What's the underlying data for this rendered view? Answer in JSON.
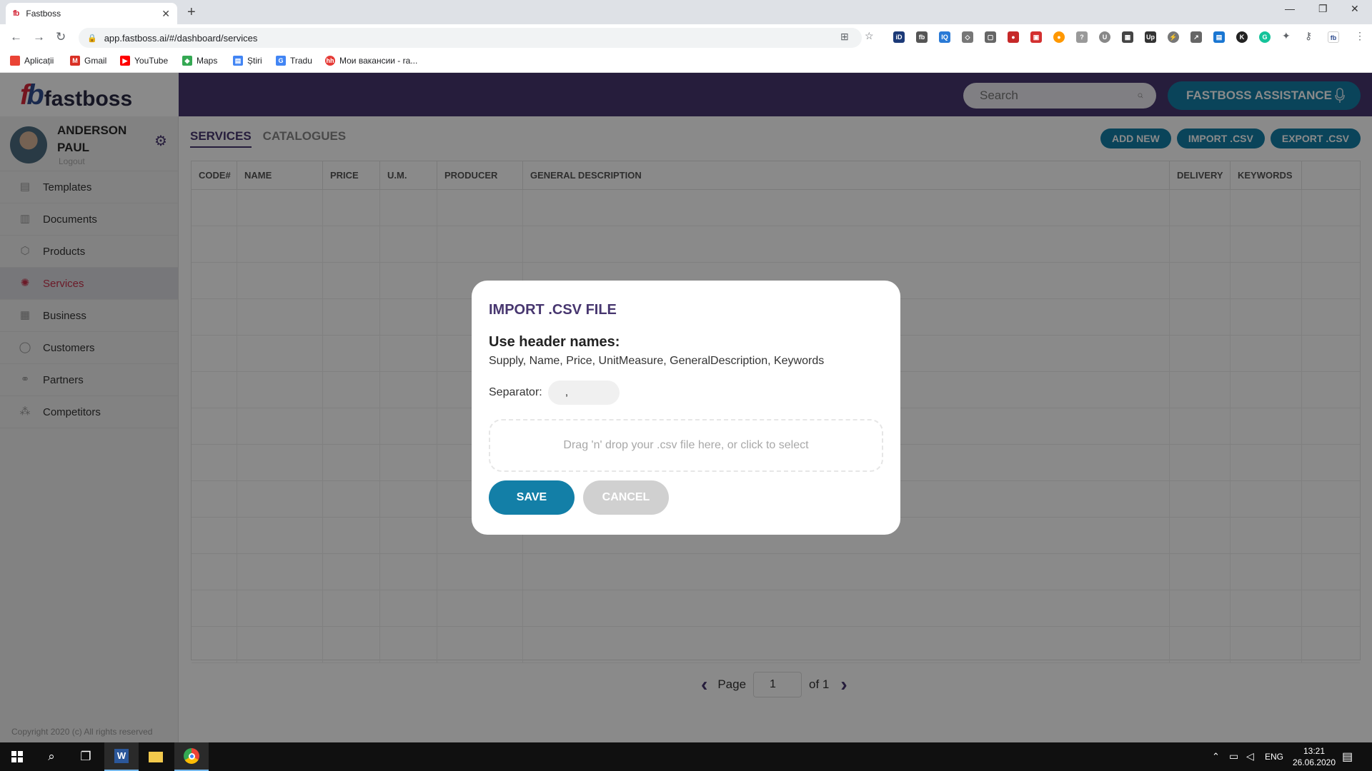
{
  "browser": {
    "tab_title": "Fastboss",
    "tab_favicon": "fb",
    "url": "app.fastboss.ai/#/dashboard/services",
    "bookmarks": [
      {
        "label": "Aplicații",
        "color": "#ea4335"
      },
      {
        "label": "Gmail",
        "color": "#d93025"
      },
      {
        "label": "YouTube",
        "color": "#ff0000"
      },
      {
        "label": "Maps",
        "color": "#34a853"
      },
      {
        "label": "Știri",
        "color": "#4285f4"
      },
      {
        "label": "Tradu",
        "color": "#4285f4"
      },
      {
        "label": "Мои вакансии - ra...",
        "color": "#e53935"
      }
    ]
  },
  "app": {
    "logo_mark": "fb",
    "logo_text": "fastboss",
    "search_placeholder": "Search",
    "assistance_label": "FASTBOSS ASSISTANCE",
    "brand_color": "#47366f",
    "accent_color": "#137fa7",
    "active_color": "#c6314b"
  },
  "sidebar": {
    "user_name": "ANDERSON PAUL",
    "logout": "Logout",
    "items": [
      {
        "label": "Templates",
        "icon": "templates-icon",
        "glyph": "▤"
      },
      {
        "label": "Documents",
        "icon": "documents-icon",
        "glyph": "▥"
      },
      {
        "label": "Products",
        "icon": "products-icon",
        "glyph": "⬡"
      },
      {
        "label": "Services",
        "icon": "services-icon",
        "glyph": "✺"
      },
      {
        "label": "Business",
        "icon": "business-icon",
        "glyph": "▦"
      },
      {
        "label": "Customers",
        "icon": "customers-icon",
        "glyph": "◯"
      },
      {
        "label": "Partners",
        "icon": "partners-icon",
        "glyph": "⚭"
      },
      {
        "label": "Competitors",
        "icon": "competitors-icon",
        "glyph": "⁂"
      }
    ],
    "active_item": "Services",
    "copyright": "Copyright 2020 (c) All rights reserved"
  },
  "content": {
    "tabs": [
      "SERVICES",
      "CATALOGUES"
    ],
    "active_tab": "SERVICES",
    "actions": [
      "ADD NEW",
      "IMPORT .CSV",
      "EXPORT .CSV"
    ],
    "columns": [
      "CODE#",
      "NAME",
      "PRICE",
      "U.M.",
      "PRODUCER",
      "GENERAL DESCRIPTION",
      "DELIVERY",
      "KEYWORDS",
      ""
    ],
    "pagination": {
      "page_label": "Page",
      "current_page": "1",
      "of_label": "of 1"
    }
  },
  "modal": {
    "title": "IMPORT .CSV FILE",
    "subtitle": "Use header names:",
    "description": "Supply, Name, Price, UnitMeasure, GeneralDescription, Keywords",
    "separator_label": "Separator:",
    "separator_value": ",",
    "dropzone_text": "Drag 'n' drop your .csv file here, or click to select",
    "save_label": "SAVE",
    "cancel_label": "CANCEL"
  },
  "taskbar": {
    "language": "ENG",
    "time": "13:21",
    "date": "26.06.2020"
  }
}
